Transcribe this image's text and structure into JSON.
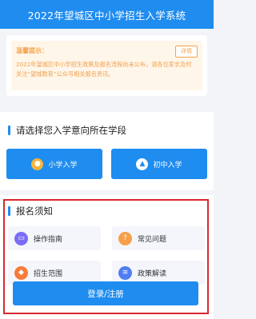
{
  "header": {
    "title": "2022年望城区中小学招生入学系统"
  },
  "notice": {
    "title": "温馨提示：",
    "tag": "详情",
    "text": "2022年望城区中小学招生政策及报名流程尚未公布，请各位家长及时关注“望城教育”公众号相关报名资讯。"
  },
  "school_select": {
    "title": "请选择您入学意向所在学段",
    "primary_label": "小学入学",
    "junior_label": "初中入学"
  },
  "guide": {
    "title": "报名须知",
    "items": [
      {
        "label": "操作指南",
        "icon": "monitor-icon",
        "color": "#7b6cf6"
      },
      {
        "label": "常见问题",
        "icon": "chat-icon",
        "color": "#f6a04a"
      },
      {
        "label": "招生范围",
        "icon": "map-icon",
        "color": "#f57c3b"
      },
      {
        "label": "政策解读",
        "icon": "document-icon",
        "color": "#4f7ef3"
      }
    ]
  },
  "login": {
    "label": "登录/注册"
  },
  "colors": {
    "primary": "#1f8cf0",
    "notice": "#f3a24a",
    "highlight": "#d9272e"
  }
}
